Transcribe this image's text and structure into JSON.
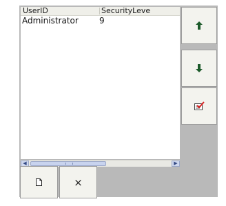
{
  "table": {
    "columns": [
      "UserID",
      "SecurityLeve"
    ],
    "rows": [
      [
        "Administrator",
        "9"
      ]
    ]
  },
  "buttons": {
    "move_up_icon": "up-arrow-icon",
    "move_down_icon": "down-arrow-icon",
    "edit_icon": "edit-checklist-icon",
    "new_icon": "new-document-icon",
    "delete_label": "×"
  },
  "colors": {
    "arrow_green": "#1c5a2a",
    "edit_check_red": "#d62020",
    "panel_gray": "#b9b9b9"
  }
}
